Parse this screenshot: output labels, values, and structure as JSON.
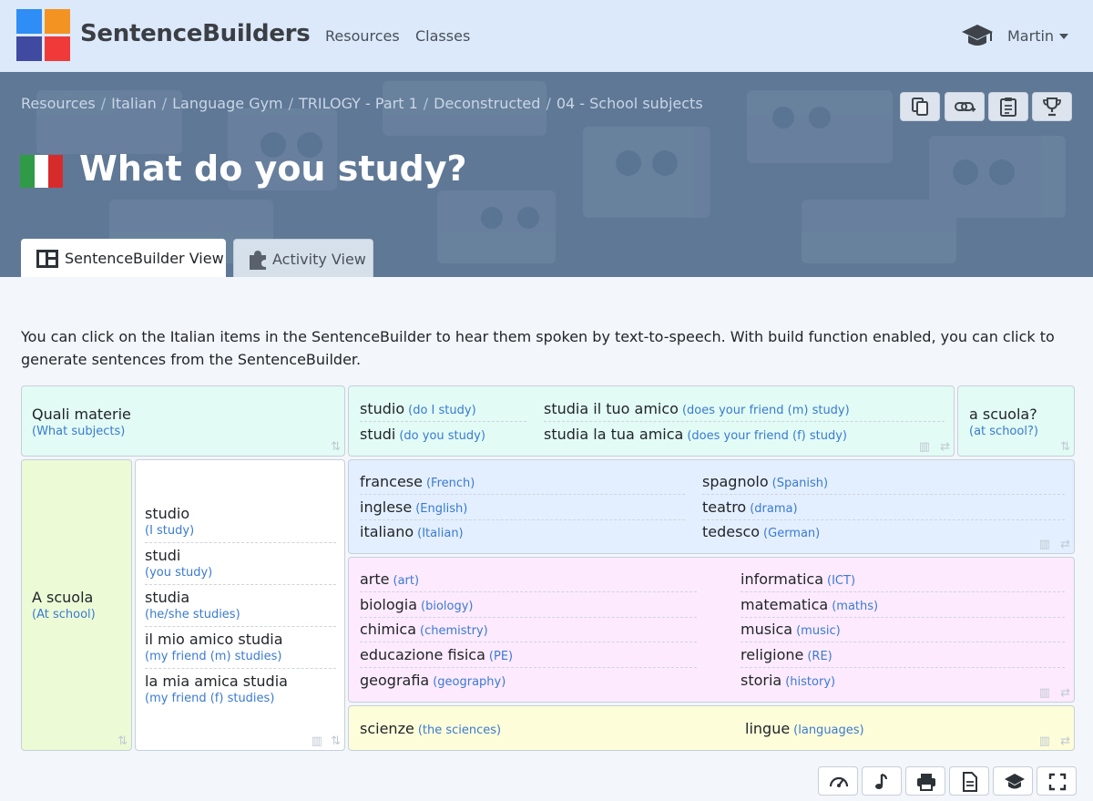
{
  "nav": {
    "brand": "SentenceBuilders",
    "links": [
      "Resources",
      "Classes"
    ],
    "user": "Martin",
    "logo_colors": [
      "#2e8ef5",
      "#f39321",
      "#3f4aa0",
      "#f03a3a"
    ]
  },
  "breadcrumb": [
    "Resources",
    "Italian",
    "Language Gym",
    "TRILOGY - Part 1",
    "Deconstructed",
    "04 - School subjects"
  ],
  "header_tools": [
    "copy-icon",
    "link-icon",
    "clipboard-icon",
    "trophy-icon"
  ],
  "title": "What do you study?",
  "flag_colors": [
    "#2f9b47",
    "#ffffff",
    "#d72b2b"
  ],
  "tabs": {
    "sentencebuilder": "SentenceBuilder View",
    "activity": "Activity View"
  },
  "intro": "You can click on the Italian items in the SentenceBuilder to hear them spoken by text-to-speech. With build function enabled, you can click to generate sentences from the SentenceBuilder.",
  "builder": {
    "quali": {
      "it": "Quali materie",
      "en": "(What subjects)"
    },
    "verbs_top": [
      {
        "it": "studio",
        "en": "(do I study)"
      },
      {
        "it": "studi",
        "en": "(do you study)"
      },
      {
        "it": "studia il tuo amico",
        "en": "(does your friend (m) study)"
      },
      {
        "it": "studia la tua amica",
        "en": "(does your friend (f) study)"
      }
    ],
    "a_scuola_q": {
      "it": "a scuola?",
      "en": "(at school?)"
    },
    "a_scuola": {
      "it": "A scuola",
      "en": "(At school)"
    },
    "verbs": [
      {
        "it": "studio",
        "en": "(I study)"
      },
      {
        "it": "studi",
        "en": "(you study)"
      },
      {
        "it": "studia",
        "en": "(he/she studies)"
      },
      {
        "it": "il mio amico studia",
        "en": "(my friend (m) studies)"
      },
      {
        "it": "la mia amica studia",
        "en": "(my friend (f) studies)"
      }
    ],
    "languages": [
      {
        "it": "francese",
        "en": "(French)"
      },
      {
        "it": "inglese",
        "en": "(English)"
      },
      {
        "it": "italiano",
        "en": "(Italian)"
      },
      {
        "it": "spagnolo",
        "en": "(Spanish)"
      },
      {
        "it": "teatro",
        "en": "(drama)"
      },
      {
        "it": "tedesco",
        "en": "(German)"
      }
    ],
    "subjects": [
      {
        "it": "arte",
        "en": "(art)"
      },
      {
        "it": "biologia",
        "en": "(biology)"
      },
      {
        "it": "chimica",
        "en": "(chemistry)"
      },
      {
        "it": "educazione fisica",
        "en": "(PE)"
      },
      {
        "it": "geografia",
        "en": "(geography)"
      },
      {
        "it": "informatica",
        "en": "(ICT)"
      },
      {
        "it": "matematica",
        "en": "(maths)"
      },
      {
        "it": "musica",
        "en": "(music)"
      },
      {
        "it": "religione",
        "en": "(RE)"
      },
      {
        "it": "storia",
        "en": "(history)"
      }
    ],
    "extra": [
      {
        "it": "scienze",
        "en": "(the sciences)"
      },
      {
        "it": "lingue",
        "en": "(languages)"
      }
    ]
  },
  "bottom_tools": [
    "speedometer-icon",
    "music-note-icon",
    "print-icon",
    "document-icon",
    "graduation-cap-icon",
    "fullscreen-icon"
  ]
}
